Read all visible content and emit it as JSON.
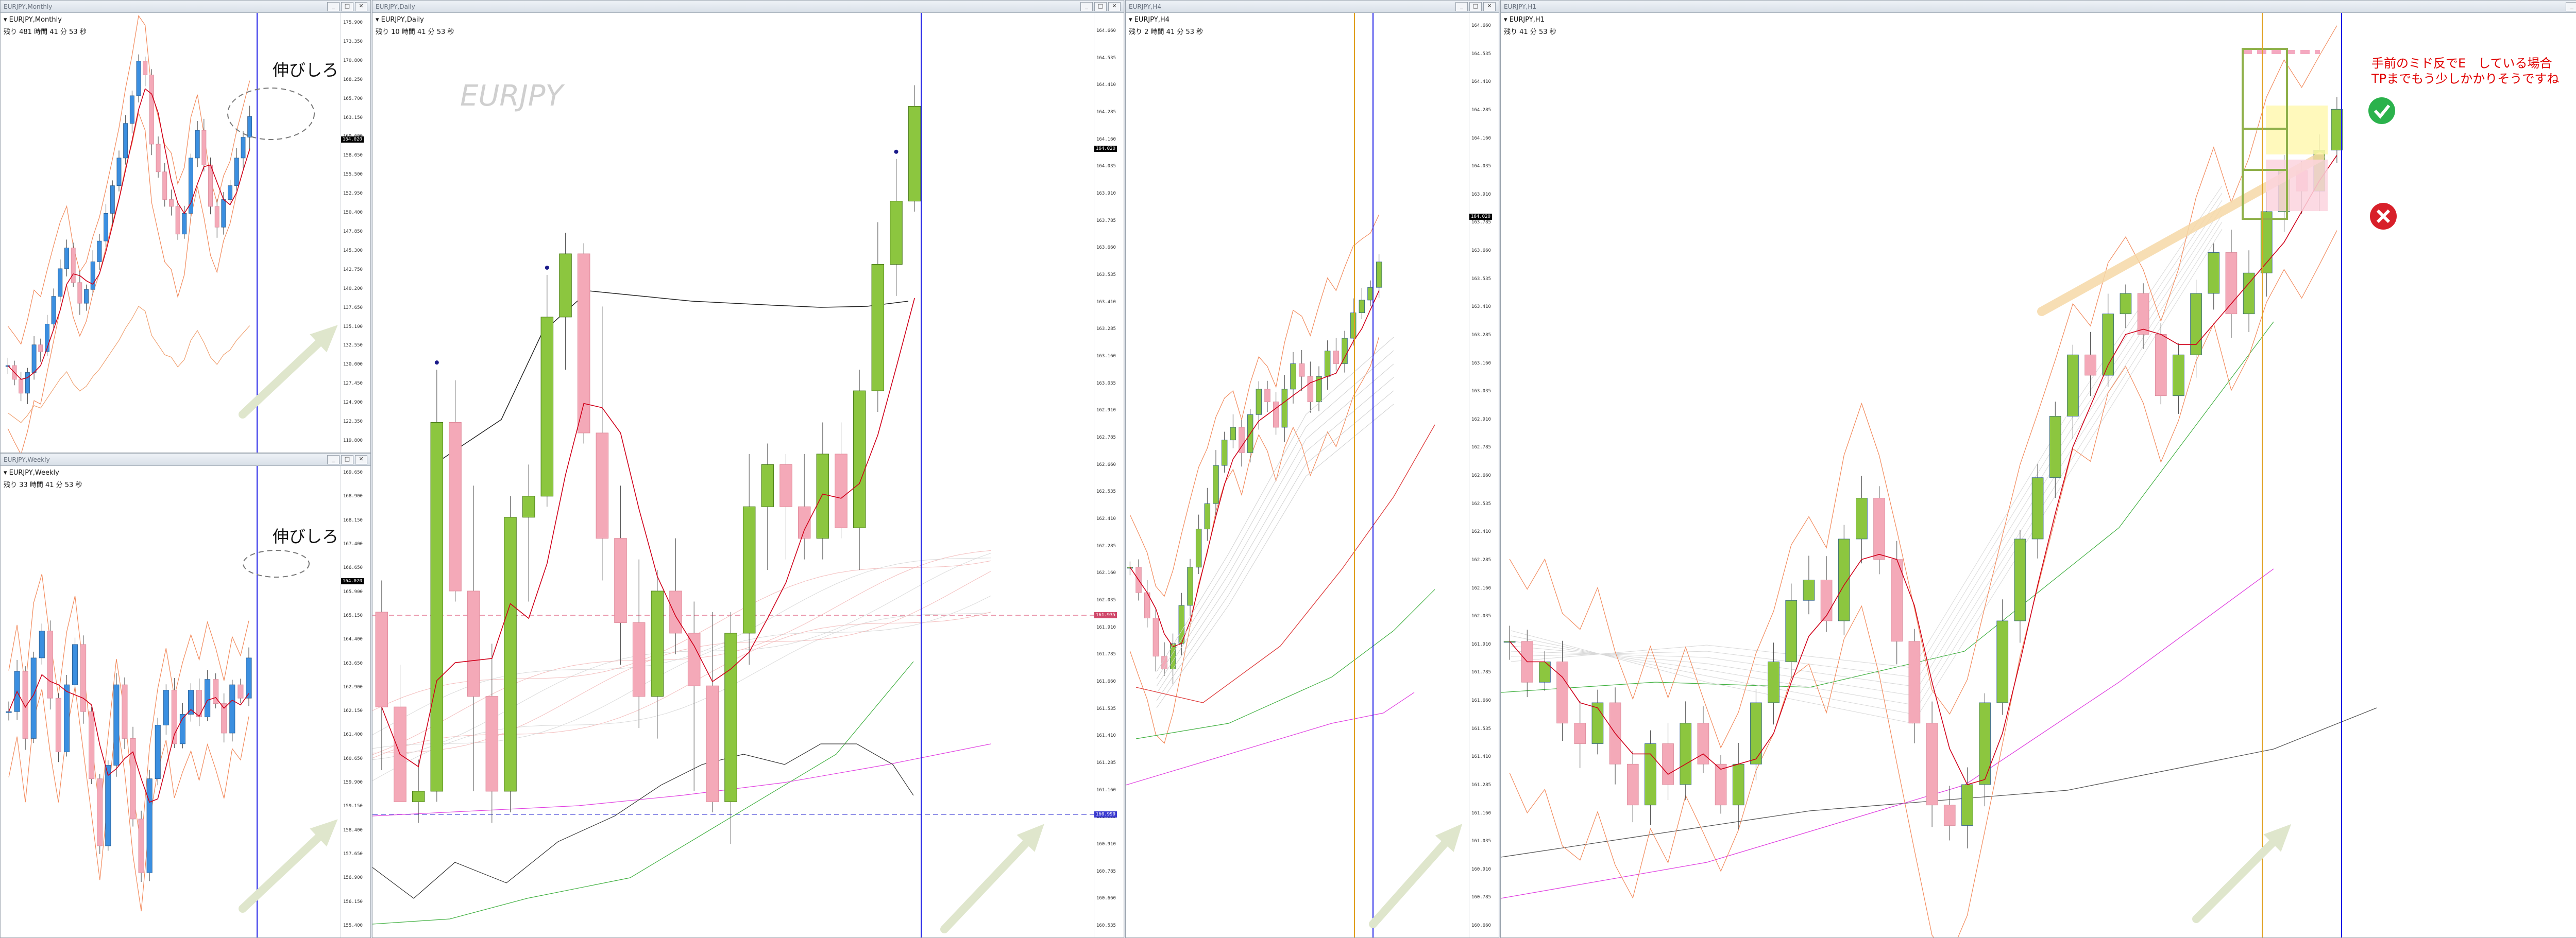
{
  "windows": {
    "monthly": {
      "title": "EURJPY,Monthly",
      "symbol_line": "▾ EURJPY,Monthly",
      "timer_line": "残り 481 時間 41 分 53 秒",
      "annotation": "伸びしろ"
    },
    "weekly": {
      "title": "EURJPY,Weekly",
      "symbol_line": "▾ EURJPY,Weekly",
      "timer_line": "残り 33 時間 41 分 53 秒",
      "annotation": "伸びしろ"
    },
    "daily": {
      "title": "EURJPY,Daily",
      "symbol_line": "▾ EURJPY,Daily",
      "timer_line": "残り 10 時間 41 分 53 秒",
      "watermark": "EURJPY"
    },
    "h4": {
      "title": "EURJPY,H4",
      "symbol_line": "▾ EURJPY,H4",
      "timer_line": "残り 2 時間 41 分 53 秒"
    },
    "h1": {
      "title": "EURJPY,H1",
      "symbol_line": "▾ EURJPY,H1",
      "timer_line": "残り 41 分 53 秒",
      "note_line1": "手前のミド反でE　している場合",
      "note_line2": "TPまでもう少しかかりそうですね"
    }
  },
  "window_buttons": {
    "min": "_",
    "max": "□",
    "close": "✕"
  },
  "colors": {
    "bull_daily": "#8cc63f",
    "bear": "#f4a9b8",
    "bull_other": "#3b8fe0",
    "ma_red": "#d0001a",
    "ma_black": "#222222",
    "cursor_blue": "#1a1ae6",
    "cursor_orange": "#e0a020",
    "arrow": "#dfe6cc",
    "note_red": "#e00000"
  },
  "chart_data": [
    {
      "type": "candlestick",
      "timeframe": "Daily",
      "symbol": "EURJPY",
      "y_ticks": [
        "164.660",
        "164.535",
        "164.410",
        "164.285",
        "164.160",
        "164.035",
        "163.910",
        "163.785",
        "163.660",
        "163.535",
        "163.410",
        "163.285",
        "163.160",
        "163.035",
        "162.910",
        "162.785",
        "162.660",
        "162.535",
        "162.410",
        "162.285",
        "162.160",
        "162.035",
        "161.910",
        "161.785",
        "161.660",
        "161.535",
        "161.410",
        "161.285",
        "161.160",
        "161.035",
        "160.910",
        "160.785",
        "160.660",
        "160.535"
      ],
      "ylim": [
        160.45,
        164.72
      ],
      "current_price": "164.020",
      "level_pink": "161.935",
      "level_purple": "160.990",
      "candles": [
        {
          "o": 161.95,
          "h": 162.1,
          "l": 161.2,
          "c": 161.5
        },
        {
          "o": 161.5,
          "h": 161.7,
          "l": 161.1,
          "c": 161.05
        },
        {
          "o": 161.05,
          "h": 161.25,
          "l": 160.95,
          "c": 161.1
        },
        {
          "o": 161.1,
          "h": 163.1,
          "l": 161.05,
          "c": 162.85
        },
        {
          "o": 162.85,
          "h": 163.05,
          "l": 162.0,
          "c": 162.05
        },
        {
          "o": 162.05,
          "h": 162.55,
          "l": 161.1,
          "c": 161.55
        },
        {
          "o": 161.55,
          "h": 161.8,
          "l": 160.95,
          "c": 161.1
        },
        {
          "o": 161.1,
          "h": 162.5,
          "l": 161.0,
          "c": 162.4
        },
        {
          "o": 162.4,
          "h": 162.65,
          "l": 162.0,
          "c": 162.5
        },
        {
          "o": 162.5,
          "h": 163.55,
          "l": 162.45,
          "c": 163.35
        },
        {
          "o": 163.35,
          "h": 163.75,
          "l": 163.1,
          "c": 163.65
        },
        {
          "o": 163.65,
          "h": 163.7,
          "l": 162.75,
          "c": 162.8
        },
        {
          "o": 162.8,
          "h": 163.4,
          "l": 162.1,
          "c": 162.3
        },
        {
          "o": 162.3,
          "h": 162.55,
          "l": 161.7,
          "c": 161.9
        },
        {
          "o": 161.9,
          "h": 162.2,
          "l": 161.4,
          "c": 161.55
        },
        {
          "o": 161.55,
          "h": 162.15,
          "l": 161.35,
          "c": 162.05
        },
        {
          "o": 162.05,
          "h": 162.3,
          "l": 161.75,
          "c": 161.85
        },
        {
          "o": 161.85,
          "h": 162.0,
          "l": 161.1,
          "c": 161.6
        },
        {
          "o": 161.6,
          "h": 161.95,
          "l": 161.0,
          "c": 161.05
        },
        {
          "o": 161.05,
          "h": 161.95,
          "l": 160.85,
          "c": 161.85
        },
        {
          "o": 161.85,
          "h": 162.7,
          "l": 161.7,
          "c": 162.45
        },
        {
          "o": 162.45,
          "h": 162.75,
          "l": 162.15,
          "c": 162.65
        },
        {
          "o": 162.65,
          "h": 162.7,
          "l": 162.2,
          "c": 162.45
        },
        {
          "o": 162.45,
          "h": 162.7,
          "l": 162.2,
          "c": 162.3
        },
        {
          "o": 162.3,
          "h": 162.85,
          "l": 162.2,
          "c": 162.7
        },
        {
          "o": 162.7,
          "h": 162.85,
          "l": 162.3,
          "c": 162.35
        },
        {
          "o": 162.35,
          "h": 163.1,
          "l": 162.15,
          "c": 163.0
        },
        {
          "o": 163.0,
          "h": 163.8,
          "l": 162.9,
          "c": 163.6
        },
        {
          "o": 163.6,
          "h": 164.1,
          "l": 163.45,
          "c": 163.9
        },
        {
          "o": 163.9,
          "h": 164.45,
          "l": 163.85,
          "c": 164.35
        }
      ]
    },
    {
      "type": "candlestick",
      "timeframe": "Monthly",
      "symbol": "EURJPY",
      "ylim": [
        119.0,
        176.0
      ],
      "y_ticks": [
        "175.900",
        "173.350",
        "170.800",
        "168.250",
        "165.700",
        "163.150",
        "160.600",
        "158.050",
        "155.500",
        "152.950",
        "150.400",
        "147.850",
        "145.300",
        "142.750",
        "140.200",
        "137.650",
        "135.100",
        "132.550",
        "130.000",
        "127.450",
        "124.900",
        "122.350",
        "119.800"
      ],
      "current_price": "164.020",
      "closes": [
        128,
        126,
        124,
        127,
        131,
        130,
        134,
        138,
        142,
        145,
        140,
        137,
        139,
        143,
        146,
        150,
        154,
        158,
        163,
        167,
        172,
        170,
        160,
        156,
        152,
        151,
        147,
        150,
        158,
        162,
        157,
        151,
        148,
        152,
        154,
        158,
        161,
        164
      ]
    },
    {
      "type": "candlestick",
      "timeframe": "Weekly",
      "symbol": "EURJPY",
      "ylim": [
        154.7,
        170.0
      ],
      "y_ticks": [
        "169.650",
        "168.900",
        "168.150",
        "167.400",
        "166.650",
        "165.900",
        "165.150",
        "164.400",
        "163.650",
        "162.900",
        "162.150",
        "161.400",
        "160.650",
        "159.900",
        "159.150",
        "158.400",
        "157.650",
        "156.900",
        "156.150",
        "155.400"
      ],
      "current_price": "164.020",
      "closes": [
        162,
        163.5,
        161,
        164,
        165,
        162.5,
        160.5,
        163,
        164.5,
        162,
        159.5,
        157,
        160,
        163,
        161,
        158,
        156,
        159.5,
        161.5,
        162.8,
        160.8,
        161.9,
        162.8,
        161.8,
        163.2,
        162.3,
        161.2,
        163,
        162.5,
        164
      ]
    },
    {
      "type": "candlestick",
      "timeframe": "H4",
      "symbol": "EURJPY",
      "ylim": [
        160.6,
        164.72
      ],
      "y_ticks": [
        "164.660",
        "164.535",
        "164.410",
        "164.285",
        "164.160",
        "164.035",
        "163.910",
        "163.785",
        "163.660",
        "163.535",
        "163.410",
        "163.285",
        "163.160",
        "163.035",
        "162.910",
        "162.785",
        "162.660",
        "162.535",
        "162.410",
        "162.285",
        "162.160",
        "162.035",
        "161.910",
        "161.785",
        "161.660",
        "161.535",
        "161.410",
        "161.285",
        "161.160",
        "161.035",
        "160.910",
        "160.785",
        "160.660"
      ],
      "current_price": "164.020",
      "closes": [
        161.9,
        161.7,
        161.5,
        161.2,
        161.1,
        161.3,
        161.6,
        161.9,
        162.2,
        162.4,
        162.7,
        162.9,
        163.0,
        162.8,
        163.1,
        163.3,
        163.2,
        163.0,
        163.3,
        163.5,
        163.4,
        163.2,
        163.4,
        163.6,
        163.5,
        163.7,
        163.9,
        164.0,
        164.1,
        164.3
      ]
    },
    {
      "type": "candlestick",
      "timeframe": "H1",
      "symbol": "EURJPY",
      "ylim": [
        160.7,
        164.72
      ],
      "y_ticks": [
        "164.660",
        "164.535",
        "164.410",
        "164.285",
        "164.160",
        "164.035",
        "163.910",
        "163.785",
        "163.660",
        "163.535",
        "163.410",
        "163.285",
        "163.160",
        "163.035",
        "162.910",
        "162.785",
        "162.660",
        "162.535",
        "162.410",
        "162.285",
        "162.160",
        "162.035",
        "161.910",
        "161.785",
        "161.660",
        "161.535",
        "161.410",
        "161.285",
        "161.160",
        "161.035",
        "160.910",
        "160.785"
      ],
      "current_price": "164.020",
      "closes": [
        161.8,
        161.6,
        161.7,
        161.4,
        161.3,
        161.5,
        161.2,
        161.0,
        161.3,
        161.1,
        161.4,
        161.2,
        161.0,
        161.2,
        161.5,
        161.7,
        162.0,
        162.1,
        161.9,
        162.3,
        162.5,
        162.2,
        161.8,
        161.4,
        161.0,
        160.9,
        161.1,
        161.5,
        161.9,
        162.3,
        162.6,
        162.9,
        163.2,
        163.1,
        163.4,
        163.5,
        163.3,
        163.0,
        163.2,
        163.5,
        163.7,
        163.4,
        163.6,
        163.9,
        164.1,
        164.0,
        164.2,
        164.4
      ]
    }
  ]
}
